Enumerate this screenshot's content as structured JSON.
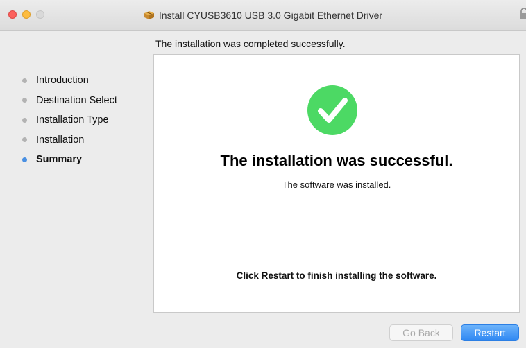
{
  "window": {
    "title": "Install CYUSB3610 USB 3.0 Gigabit Ethernet Driver"
  },
  "header": {
    "status_line": "The installation was completed successfully."
  },
  "sidebar": {
    "steps": [
      {
        "label": "Introduction",
        "active": false
      },
      {
        "label": "Destination Select",
        "active": false
      },
      {
        "label": "Installation Type",
        "active": false
      },
      {
        "label": "Installation",
        "active": false
      },
      {
        "label": "Summary",
        "active": true
      }
    ]
  },
  "panel": {
    "title": "The installation was successful.",
    "subtitle": "The software was installed.",
    "note": "Click Restart to finish installing the software."
  },
  "buttons": {
    "back": "Go Back",
    "restart": "Restart"
  },
  "colors": {
    "success": "#4cd964",
    "accent": "#2f88f3",
    "active_step": "#4a90e2"
  }
}
